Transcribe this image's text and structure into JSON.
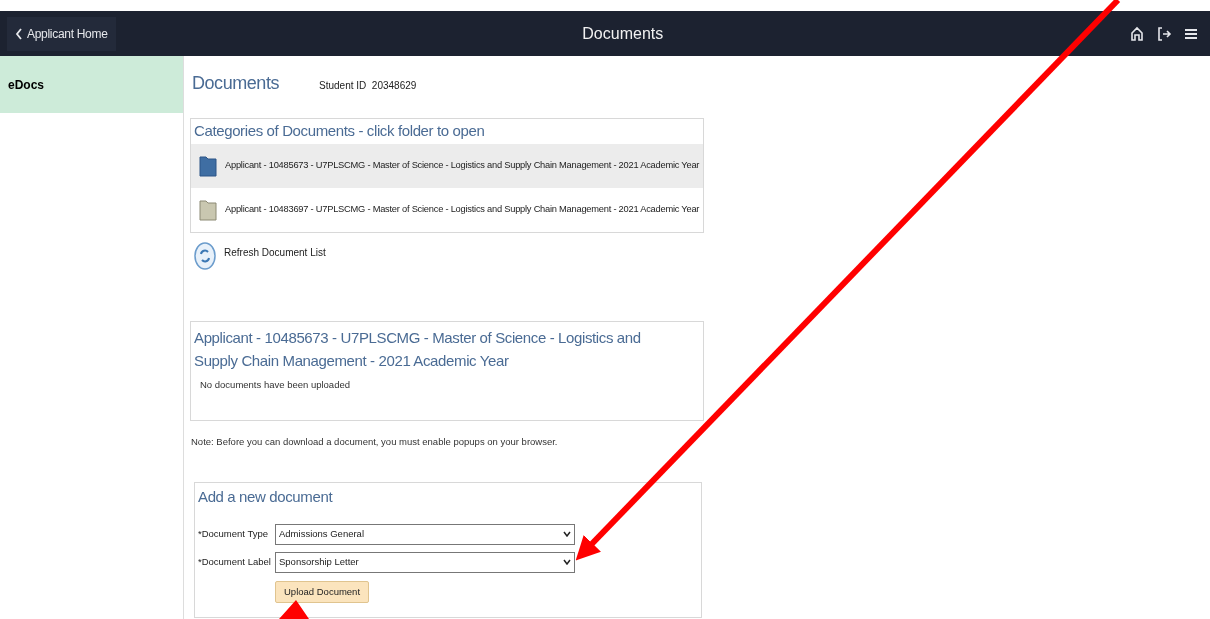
{
  "header": {
    "back_button": "Applicant Home",
    "title": "Documents"
  },
  "sidebar": {
    "items": [
      {
        "label": "eDocs",
        "selected": true
      }
    ]
  },
  "page": {
    "title": "Documents",
    "student_id_label": "Student ID",
    "student_id": "20348629"
  },
  "categories": {
    "title": "Categories of Documents - click folder to open",
    "folders": [
      {
        "label": "Applicant - 10485673 - U7PLSCMG - Master of Science - Logistics and Supply Chain Management - 2021 Academic Year",
        "selected": true
      },
      {
        "label": "Applicant - 10483697 - U7PLSCMG - Master of Science - Logistics and Supply Chain Management - 2021 Academic Year",
        "selected": false
      }
    ]
  },
  "refresh_link": "Refresh Document List",
  "folder_panel": {
    "title": "Applicant - 10485673 - U7PLSCMG - Master of Science - Logistics and Supply Chain Management - 2021 Academic Year",
    "message": "No documents have been uploaded"
  },
  "note": "Note: Before you can download a document, you must enable popups on your browser.",
  "add_document": {
    "title": "Add a new document",
    "fields": [
      {
        "label": "*Document Type",
        "value": "Admissions General"
      },
      {
        "label": "*Document Label",
        "value": "Sponsorship Letter"
      }
    ],
    "button": "Upload Document"
  }
}
